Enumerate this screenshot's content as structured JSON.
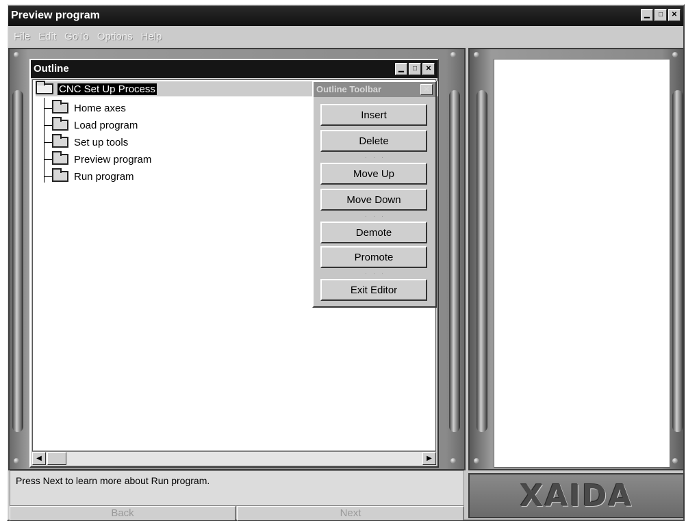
{
  "window": {
    "title": "Preview program"
  },
  "menu": [
    "File",
    "Edit",
    "GoTo",
    "Options",
    "Help"
  ],
  "outline": {
    "title": "Outline",
    "root": "CNC Set Up Process",
    "items": [
      "Home axes",
      "Load program",
      "Set up tools",
      "Preview program",
      "Run program"
    ]
  },
  "toolbar": {
    "title": "Outline Toolbar",
    "buttons": {
      "insert": "Insert",
      "delete": "Delete",
      "move_up": "Move Up",
      "move_down": "Move Down",
      "demote": "Demote",
      "promote": "Promote",
      "exit_editor": "Exit Editor"
    },
    "separator": "· · ·"
  },
  "status": {
    "text": "Press Next to learn more about Run program."
  },
  "nav": {
    "back": "Back",
    "next": "Next"
  },
  "logo": {
    "text": "XAIDA"
  },
  "icons": {
    "minimize": "minimize-icon",
    "maximize": "maximize-icon",
    "close": "close-icon",
    "folder": "folder-icon",
    "scroll_left": "arrow-left-icon",
    "scroll_right": "arrow-right-icon"
  }
}
